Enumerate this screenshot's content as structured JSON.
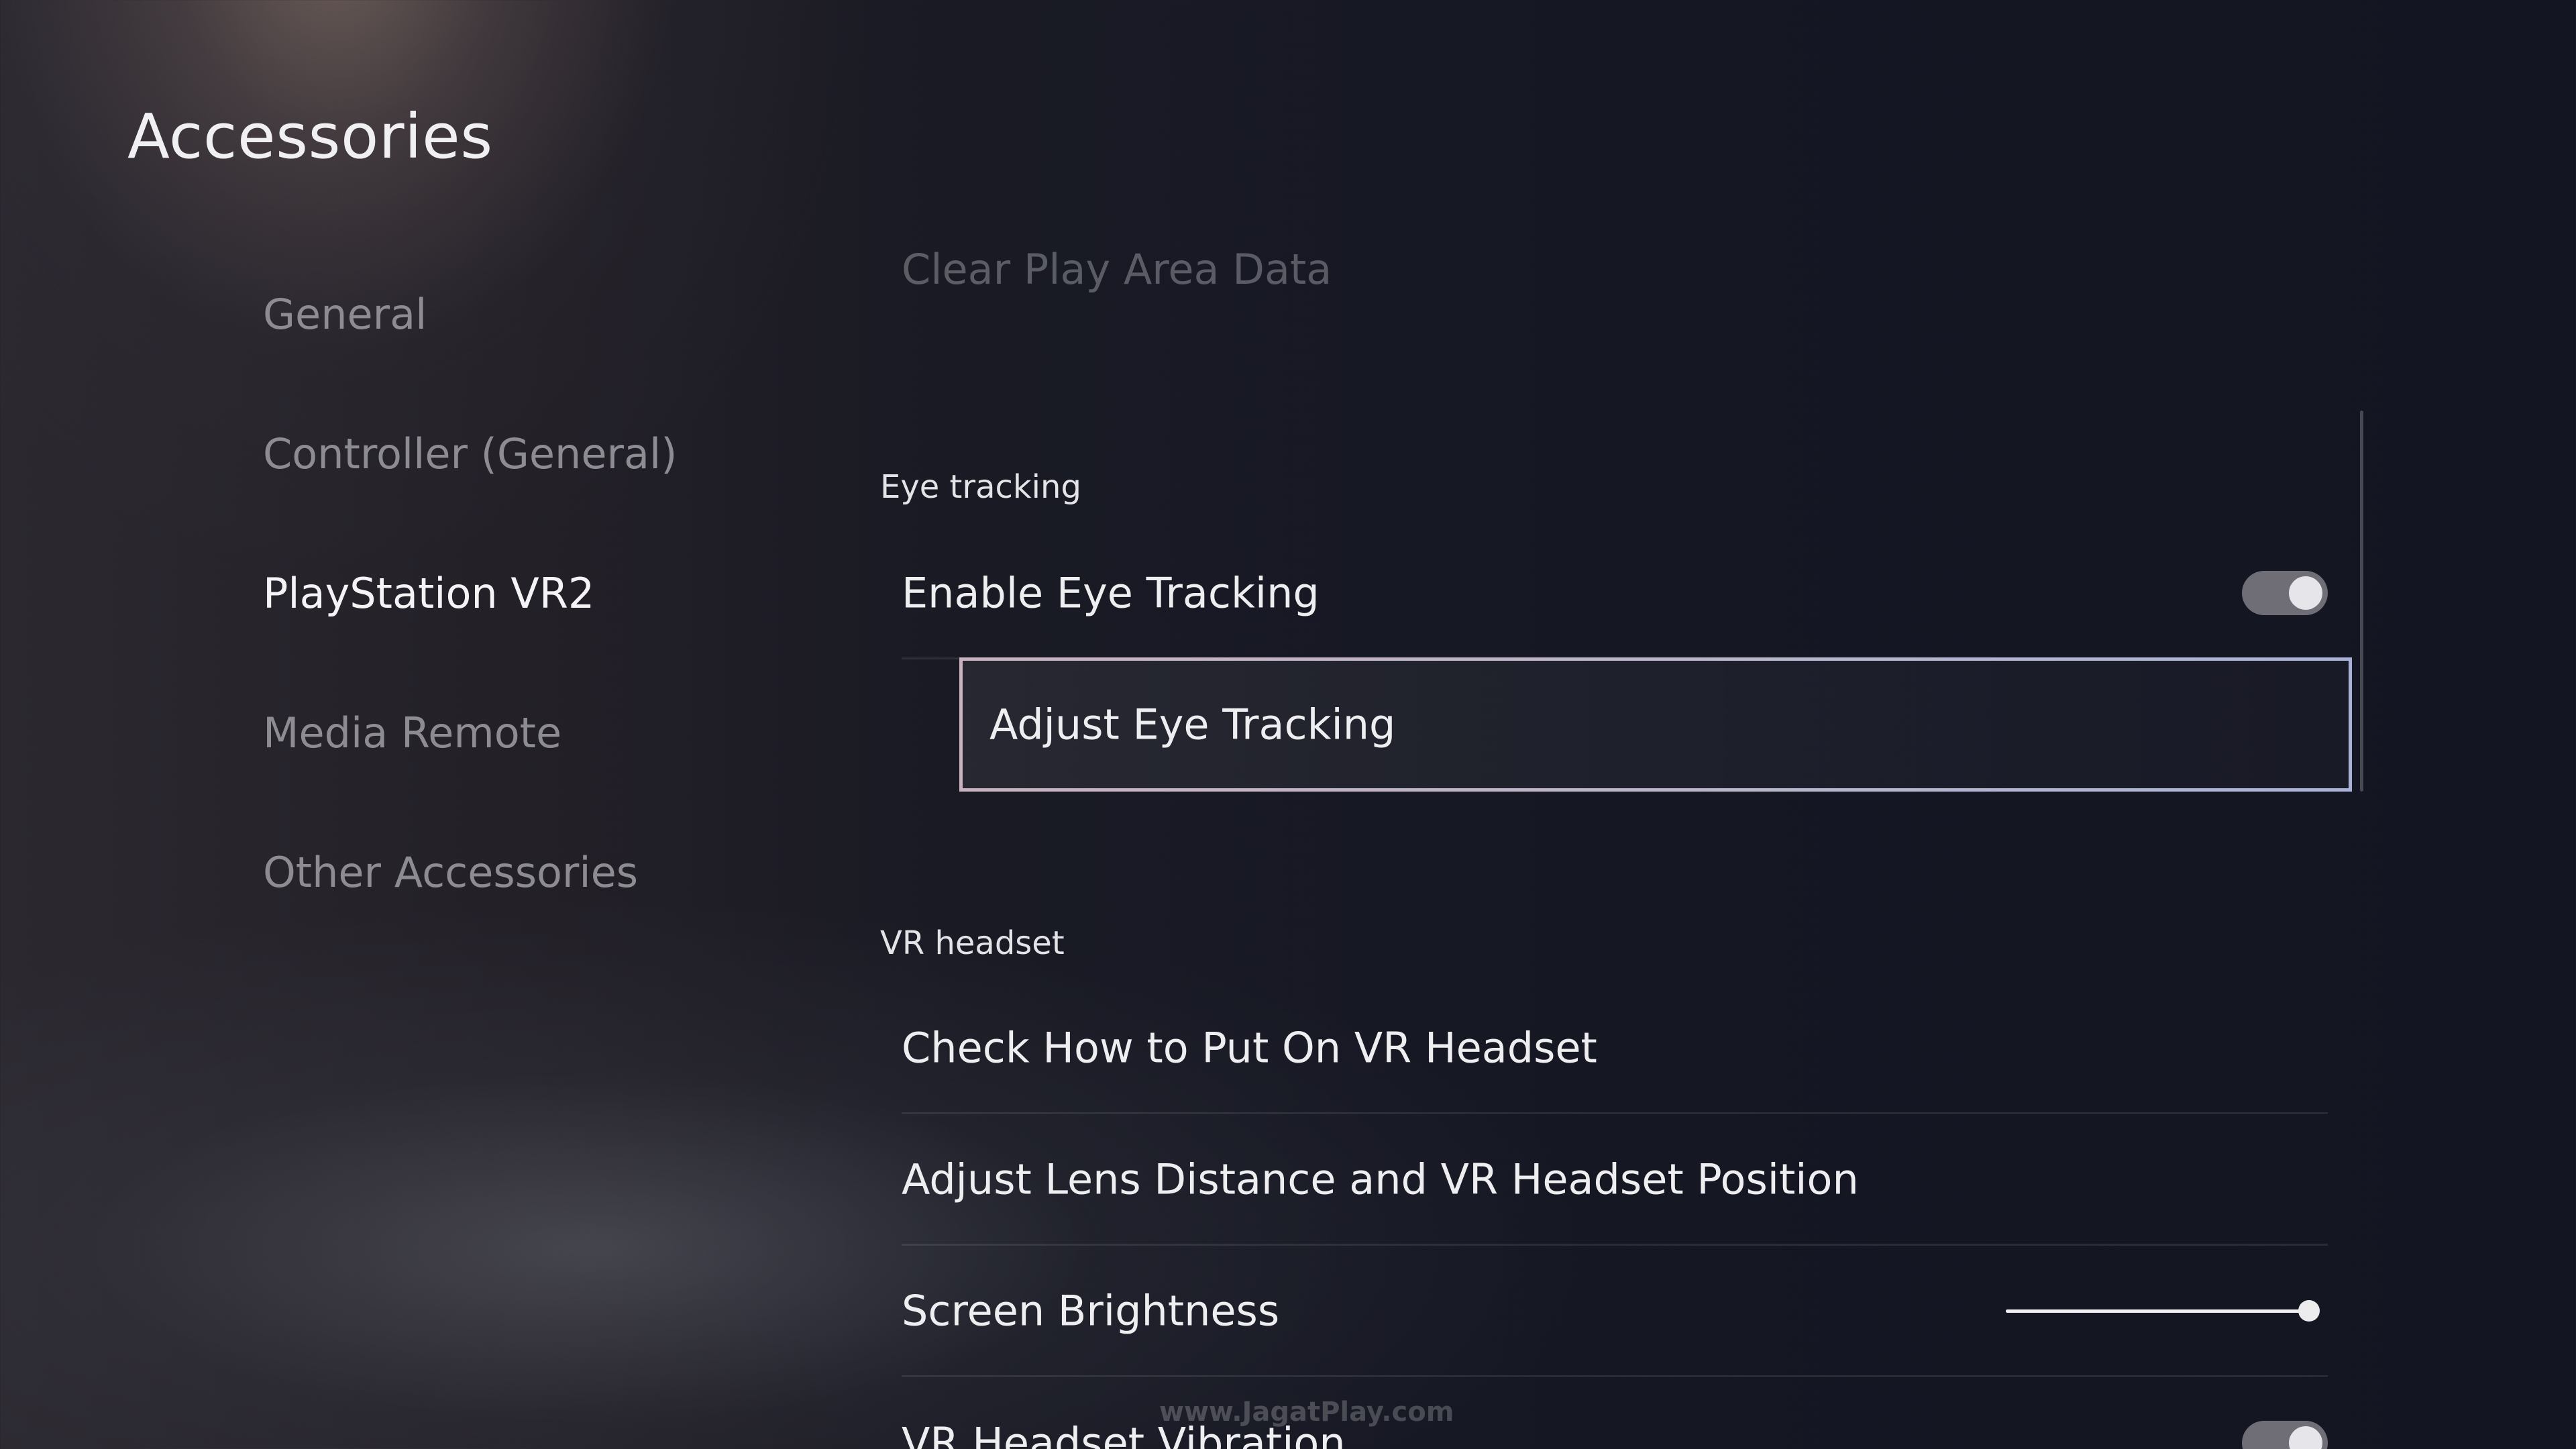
{
  "header": {
    "title": "Accessories"
  },
  "sidebar": {
    "items": [
      {
        "label": "General",
        "active": false
      },
      {
        "label": "Controller (General)",
        "active": false
      },
      {
        "label": "PlayStation VR2",
        "active": true
      },
      {
        "label": "Media Remote",
        "active": false
      },
      {
        "label": "Other Accessories",
        "active": false
      }
    ]
  },
  "main": {
    "partial_item_label": "Clear Play Area Data",
    "eye_tracking": {
      "header": "Eye tracking",
      "enable_label": "Enable Eye Tracking",
      "enable_state": "on",
      "adjust_label": "Adjust Eye Tracking"
    },
    "vr_headset": {
      "header": "VR headset",
      "check_label": "Check How to Put On VR Headset",
      "adjust_lens_label": "Adjust Lens Distance and VR Headset Position",
      "brightness_label": "Screen Brightness",
      "brightness_level": 0.97,
      "vibration_label": "VR Headset Vibration",
      "vibration_state": "on"
    }
  },
  "watermark": "www.JagatPlay.com",
  "colors": {
    "focus_border": "#c8b2bf",
    "toggle_on": "#6f6e76",
    "text_active": "#f4f4f6",
    "text_inactive": "#8d8c92"
  }
}
